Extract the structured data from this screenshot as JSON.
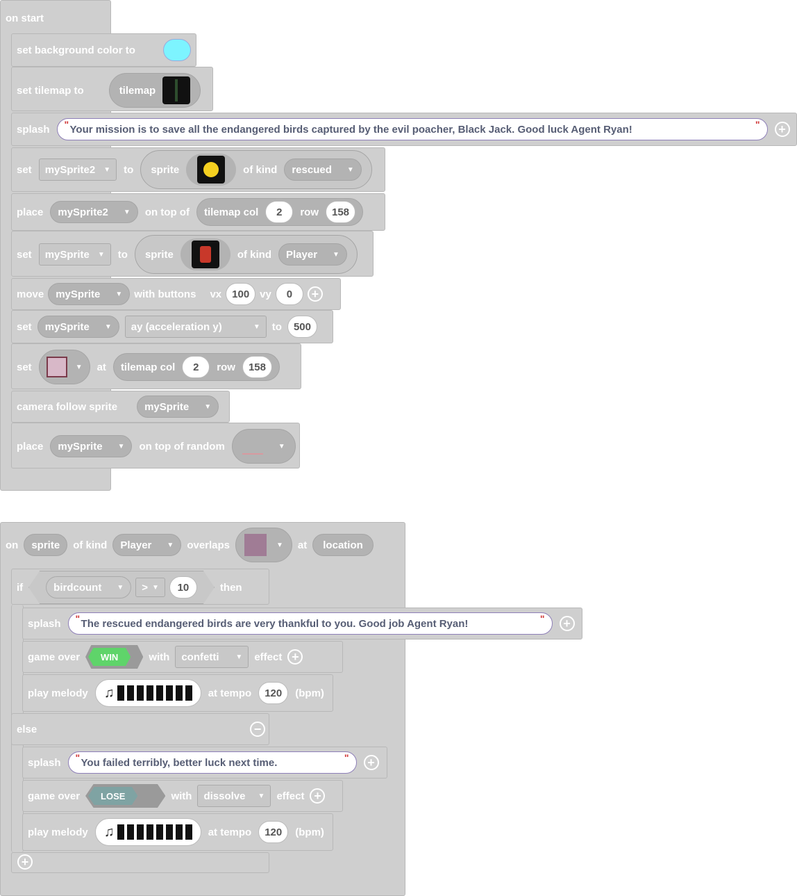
{
  "on_start": {
    "hat_label": "on start",
    "set_bg": {
      "label": "set background color to",
      "color": "#7df4ff"
    },
    "set_tilemap": {
      "label": "set tilemap to",
      "value": "tilemap"
    },
    "splash1": {
      "label": "splash",
      "text": "Your mission is to save all the endangered birds captured by the evil poacher, Black Jack. Good luck Agent Ryan!"
    },
    "set_sprite2": {
      "label_set": "set",
      "var": "mySprite2",
      "label_to": "to",
      "label_sprite": "sprite",
      "label_kind": "of kind",
      "kind": "rescued"
    },
    "place_sprite2": {
      "label": "place",
      "var": "mySprite2",
      "label_on": "on top of",
      "label_col": "tilemap col",
      "col": "2",
      "label_row": "row",
      "row": "158"
    },
    "set_sprite": {
      "label_set": "set",
      "var": "mySprite",
      "label_to": "to",
      "label_sprite": "sprite",
      "label_kind": "of kind",
      "kind": "Player"
    },
    "move": {
      "label": "move",
      "var": "mySprite",
      "label_with": "with buttons",
      "label_vx": "vx",
      "vx": "100",
      "label_vy": "vy",
      "vy": "0"
    },
    "set_ay": {
      "label_set": "set",
      "var": "mySprite",
      "prop": "ay (acceleration y)",
      "label_to": "to",
      "value": "500"
    },
    "set_tile": {
      "label_set": "set",
      "label_at": "at",
      "label_col": "tilemap col",
      "col": "2",
      "label_row": "row",
      "row": "158"
    },
    "camera": {
      "label": "camera follow sprite",
      "var": "mySprite"
    },
    "place_random": {
      "label": "place",
      "var": "mySprite",
      "label_on": "on top of random"
    }
  },
  "on_overlap": {
    "label_on": "on",
    "sprite": "sprite",
    "label_kind": "of kind",
    "kind": "Player",
    "label_overlaps": "overlaps",
    "label_at": "at",
    "location": "location",
    "if": {
      "label_if": "if",
      "var": "birdcount",
      "op": ">",
      "value": "10",
      "label_then": "then"
    },
    "splash_win": {
      "label": "splash",
      "text": "The rescued endangered birds are very thankful to you. Good job Agent Ryan!"
    },
    "gameover_win": {
      "label": "game over",
      "badge": "WIN",
      "label_with": "with",
      "effect": "confetti",
      "label_effect": "effect"
    },
    "melody1": {
      "label": "play melody",
      "label_tempo": "at tempo",
      "tempo": "120",
      "label_bpm": "(bpm)"
    },
    "else_label": "else",
    "splash_lose": {
      "label": "splash",
      "text": "You failed terribly, better luck next time."
    },
    "gameover_lose": {
      "label": "game over",
      "badge": "LOSE",
      "label_with": "with",
      "effect": "dissolve",
      "label_effect": "effect"
    },
    "melody2": {
      "label": "play melody",
      "label_tempo": "at tempo",
      "tempo": "120",
      "label_bpm": "(bpm)"
    }
  }
}
